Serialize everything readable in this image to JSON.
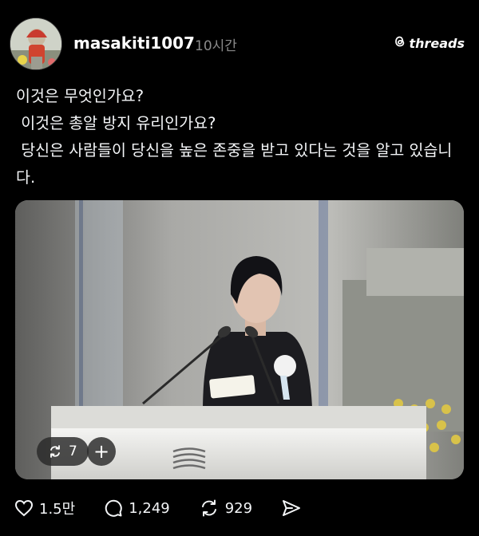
{
  "post": {
    "username": "masakiti1007",
    "time": "10시간",
    "brand": "threads",
    "text": "이것은 무엇인가요?\n 이것은 총알 방지 유리인가요?\n 당신은 사람들이 당신을 높은 존중을 받고 있다는 것을 알고 있습니다.",
    "media": {
      "repost_count": "7",
      "add_label": "+"
    },
    "actions": {
      "likes": "1.5만",
      "comments": "1,249",
      "reposts": "929"
    }
  },
  "icons": {
    "like": "heart-icon",
    "comment": "comment-bubble-icon",
    "repost": "repost-icon",
    "share": "send-icon",
    "brand": "threads-logo-icon"
  }
}
